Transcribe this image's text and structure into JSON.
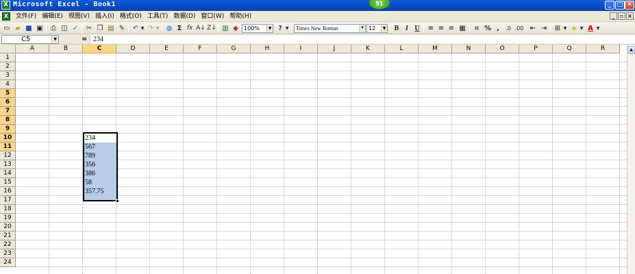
{
  "window": {
    "title": "Microsoft Excel - Book1",
    "app_icon": "excel-icon",
    "badge": "51",
    "controls": {
      "minimize": "_",
      "maximize": "□",
      "close": "✕"
    }
  },
  "menu": {
    "doc_icon": "excel-icon",
    "items": [
      {
        "label": "文件(F)"
      },
      {
        "label": "编辑(E)"
      },
      {
        "label": "视图(V)"
      },
      {
        "label": "插入(I)"
      },
      {
        "label": "格式(O)"
      },
      {
        "label": "工具(T)"
      },
      {
        "label": "数据(D)"
      },
      {
        "label": "窗口(W)"
      },
      {
        "label": "帮助(H)"
      }
    ],
    "doc_controls": {
      "minimize": "_",
      "restore": "▫",
      "close": "×"
    }
  },
  "toolbar": {
    "zoom": "100%",
    "font_name": "Times New Roman",
    "font_size": "12",
    "bold": "B",
    "italic": "I",
    "underline": "U",
    "percent": "%",
    "comma": ",",
    "sum": "Σ",
    "fx": "fx"
  },
  "formula_bar": {
    "name_box": "C5",
    "equals": "=",
    "formula": "234"
  },
  "grid": {
    "columns": [
      "A",
      "B",
      "C",
      "D",
      "E",
      "F",
      "G",
      "H",
      "I",
      "J",
      "K",
      "L",
      "M",
      "N",
      "O",
      "P",
      "Q",
      "R"
    ],
    "rows": [
      "1",
      "2",
      "3",
      "4",
      "5",
      "6",
      "7",
      "8",
      "9",
      "10",
      "11",
      "12",
      "13",
      "14",
      "15",
      "16",
      "17",
      "18",
      "19",
      "20",
      "21",
      "22",
      "23",
      "24"
    ],
    "active_column": "C",
    "active_rows": [
      "5",
      "6",
      "7",
      "8",
      "9",
      "10",
      "11"
    ],
    "cells": {
      "C5": "234",
      "C6": "567",
      "C7": "789",
      "C8": "356",
      "C9": "386",
      "C10": "58",
      "C11": "357.75"
    }
  }
}
